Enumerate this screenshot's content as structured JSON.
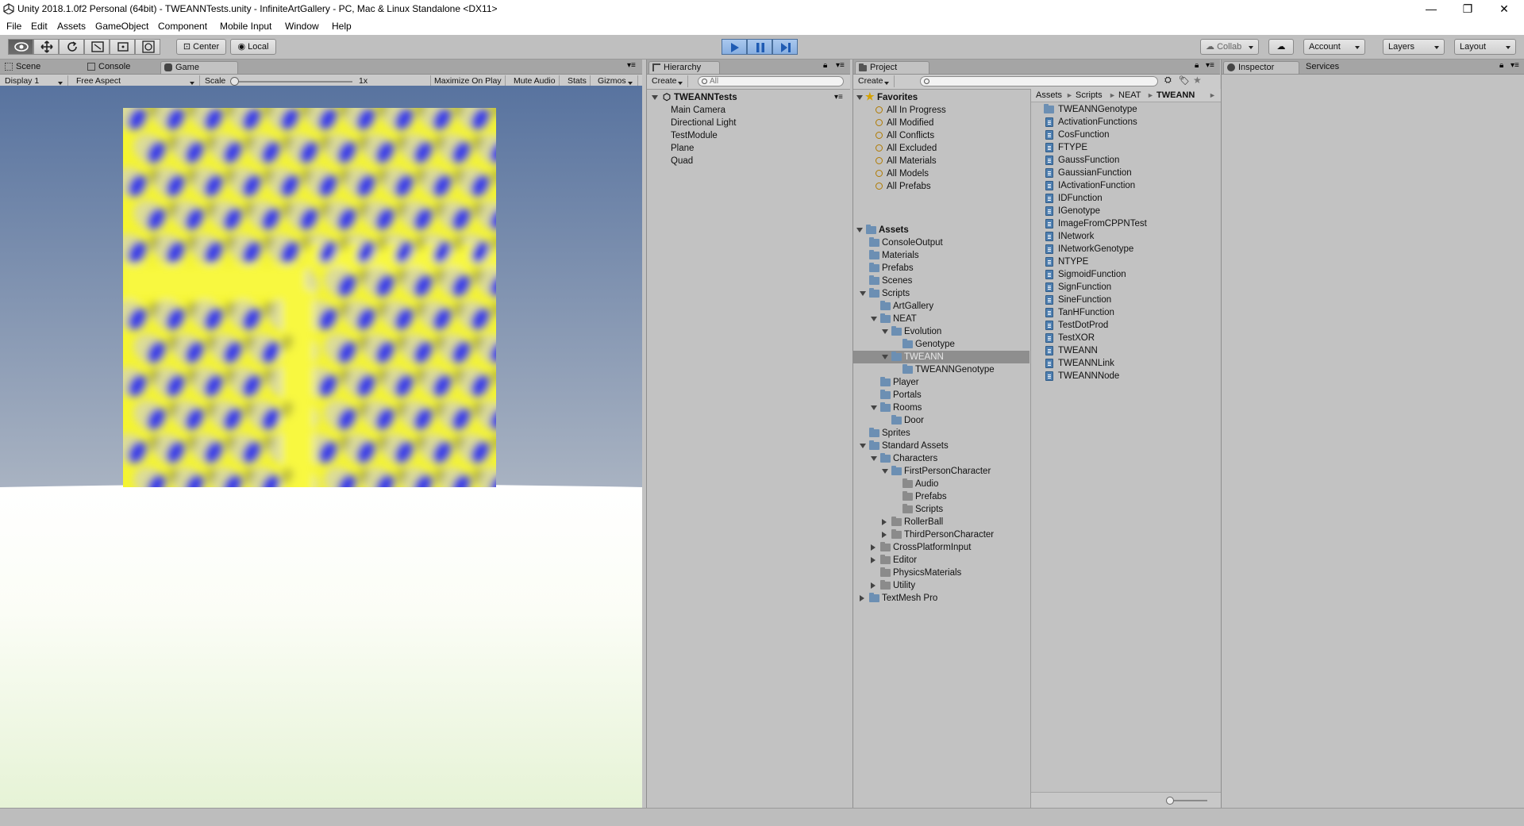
{
  "window": {
    "title": "Unity 2018.1.0f2 Personal (64bit) - TWEANNTests.unity - InfiniteArtGallery - PC, Mac & Linux Standalone <DX11>",
    "minimize": "—",
    "maximize": "❐",
    "close": "✕"
  },
  "menu": [
    "File",
    "Edit",
    "Assets",
    "GameObject",
    "Component",
    "Mobile Input",
    "Window",
    "Help"
  ],
  "toolbar": {
    "center_label": "Center",
    "local_label": "Local",
    "collab_label": "Collab",
    "account_label": "Account",
    "layers_label": "Layers",
    "layout_label": "Layout"
  },
  "game_panel": {
    "tabs": [
      "Scene",
      "Console",
      "Game"
    ],
    "display": "Display 1",
    "aspect": "Free Aspect",
    "scale_label": "Scale",
    "scale_value": "1x",
    "scale_fraction": 0.0,
    "buttons": [
      "Maximize On Play",
      "Mute Audio",
      "Stats",
      "Gizmos"
    ]
  },
  "hierarchy": {
    "tab": "Hierarchy",
    "create": "Create",
    "search_placeholder": "All",
    "scene": "TWEANNTests",
    "items": [
      "Main Camera",
      "Directional Light",
      "TestModule",
      "Plane",
      "Quad"
    ]
  },
  "project": {
    "tab": "Project",
    "create": "Create",
    "favorites_label": "Favorites",
    "favorites": [
      "All In Progress",
      "All Modified",
      "All Conflicts",
      "All Excluded",
      "All Materials",
      "All Models",
      "All Prefabs"
    ],
    "assets_label": "Assets",
    "tree": [
      {
        "label": "ConsoleOutput"
      },
      {
        "label": "Materials"
      },
      {
        "label": "Prefabs"
      },
      {
        "label": "Scenes"
      },
      {
        "label": "Scripts"
      },
      {
        "label": "ArtGallery"
      },
      {
        "label": "NEAT"
      },
      {
        "label": "Evolution"
      },
      {
        "label": "Genotype"
      },
      {
        "label": "TWEANN"
      },
      {
        "label": "TWEANNGenotype"
      },
      {
        "label": "Player"
      },
      {
        "label": "Portals"
      },
      {
        "label": "Rooms"
      },
      {
        "label": "Door"
      },
      {
        "label": "Sprites"
      },
      {
        "label": "Standard Assets"
      },
      {
        "label": "Characters"
      },
      {
        "label": "FirstPersonCharacter"
      },
      {
        "label": "Audio"
      },
      {
        "label": "Prefabs"
      },
      {
        "label": "Scripts"
      },
      {
        "label": "RollerBall"
      },
      {
        "label": "ThirdPersonCharacter"
      },
      {
        "label": "CrossPlatformInput"
      },
      {
        "label": "Editor"
      },
      {
        "label": "PhysicsMaterials"
      },
      {
        "label": "Utility"
      },
      {
        "label": "TextMesh Pro"
      }
    ],
    "breadcrumb": [
      "Assets",
      "Scripts",
      "NEAT",
      "TWEANN"
    ],
    "files": [
      "TWEANNGenotype",
      "ActivationFunctions",
      "CosFunction",
      "FTYPE",
      "GaussFunction",
      "GaussianFunction",
      "IActivationFunction",
      "IDFunction",
      "IGenotype",
      "ImageFromCPPNTest",
      "INetwork",
      "INetworkGenotype",
      "NTYPE",
      "SigmoidFunction",
      "SignFunction",
      "SineFunction",
      "TanHFunction",
      "TestDotProd",
      "TestXOR",
      "TWEANN",
      "TWEANNLink",
      "TWEANNNode"
    ]
  },
  "inspector": {
    "tabs": [
      "Inspector",
      "Services"
    ]
  },
  "colors": {
    "accent_play": "#87aee0",
    "sky_top": "#5b77a3",
    "pattern_yellow": "#f2f22e",
    "pattern_blue": "#3437e8"
  }
}
